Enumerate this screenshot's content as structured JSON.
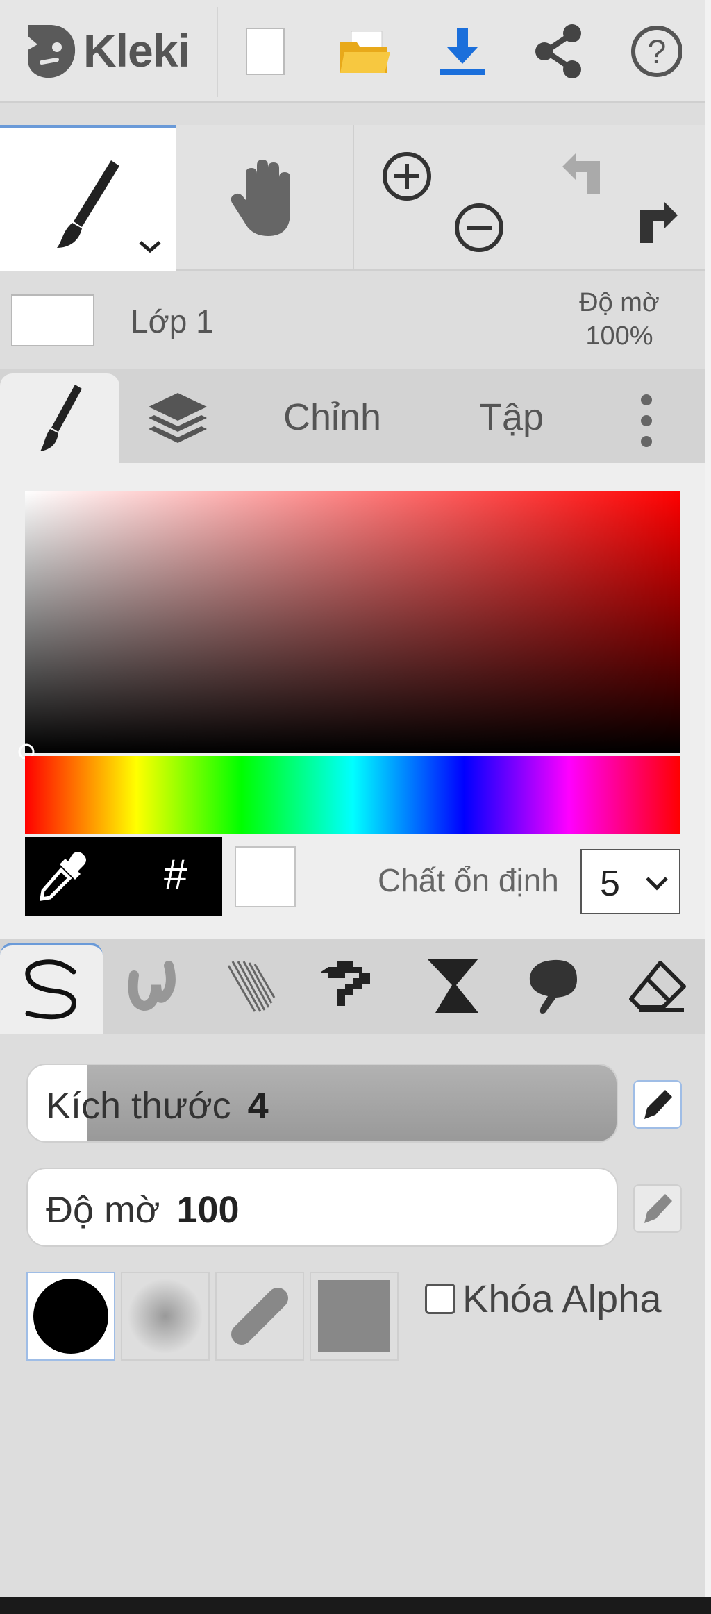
{
  "app": {
    "name": "Kleki"
  },
  "layer": {
    "name": "Lớp 1",
    "opacity_label": "Độ mờ",
    "opacity_value": "100%"
  },
  "tabs": [
    {
      "name": "brush-tab"
    },
    {
      "name": "layers-tab"
    },
    {
      "label": "Chỉnh"
    },
    {
      "label": "Tập"
    }
  ],
  "color": {
    "hash_label": "#",
    "stabilizer_label": "Chất ổn định",
    "stabilizer_value": "5",
    "current_color": "#ffffff",
    "hue_color": "#ff0000"
  },
  "brush": {
    "size_label": "Kích thước",
    "size_value": "4",
    "size_fraction": 0.1,
    "opacity_label": "Độ mờ",
    "opacity_value": "100",
    "opacity_fraction": 1.0,
    "lock_alpha_label": "Khóa Alpha",
    "lock_alpha_checked": false
  },
  "accent": "#1b6fdb"
}
